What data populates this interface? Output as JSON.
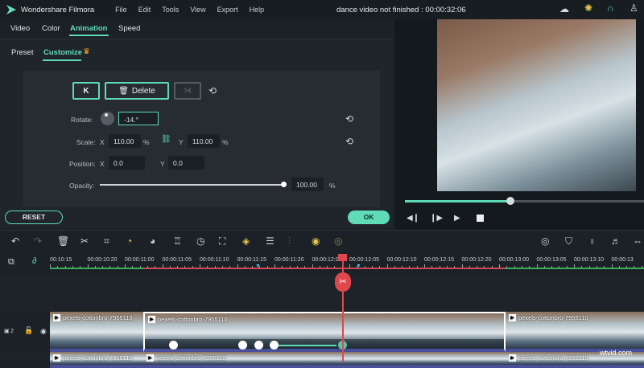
{
  "app": {
    "name": "Wondershare Filmora",
    "menu": [
      "File",
      "Edit",
      "Tools",
      "View",
      "Export",
      "Help"
    ],
    "project_title": "dance video not finished : 00:00:32:06"
  },
  "tabs": [
    "Video",
    "Color",
    "Animation",
    "Speed"
  ],
  "active_tab": "Animation",
  "subtabs": [
    "Preset",
    "Customize"
  ],
  "keyframe": {
    "delete_label": "Delete",
    "prev_icon": "K",
    "next_icon": ">I"
  },
  "props": {
    "rotate_label": "Rotate:",
    "rotate_value": "-14.°",
    "scale_label": "Scale:",
    "x": "X",
    "y": "Y",
    "scale_x": "110.00",
    "scale_y": "110.00",
    "pct": "%",
    "position_label": "Position:",
    "pos_x": "0.0",
    "pos_y": "0.0",
    "opacity_label": "Opacity:",
    "opacity_value": "100.00",
    "opacity_fraction": 1.0
  },
  "reset_label": "RESET",
  "ok_label": "OK",
  "preview": {
    "progress_fraction": 0.44
  },
  "timeline": {
    "ticks": [
      "00:10:15",
      "00:00:10:20",
      "00:00:11:00",
      "00:00:11:05",
      "00:00:11:10",
      "00:00:11:15",
      "00:00:11:20",
      "00:00:12:00",
      "00:00:12:05",
      "00:00:12:10",
      "00:00:12:15",
      "00:00:12:20",
      "00:00:13:00",
      "00:00:13:05",
      "00:00:13:10",
      "00:00:13"
    ],
    "track_number": "2",
    "clip_name": "pexels-cottonbro-7955110"
  },
  "watermark": "wtvid.com",
  "colors": {
    "accent": "#5fdcb6",
    "playhead": "#e0474c"
  }
}
